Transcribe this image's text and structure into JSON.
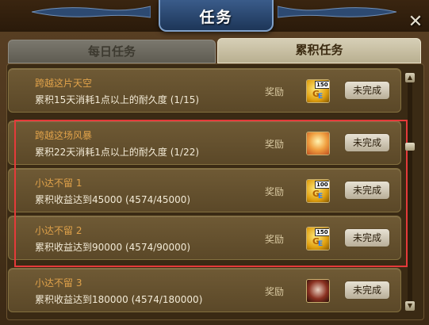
{
  "window": {
    "title": "任务",
    "close_glyph": "✕"
  },
  "tabs": [
    {
      "label": "每日任务",
      "active": false
    },
    {
      "label": "累积任务",
      "active": true
    }
  ],
  "tasks": [
    {
      "name": "跨越这片天空",
      "desc": "累积15天消耗1点以上的耐久度 (1/15)",
      "reward_label": "奖励",
      "reward_icon": "gold-150-icon",
      "reward_badge": "150",
      "button": "未完成"
    },
    {
      "name": "跨越这场风暴",
      "desc": "累积22天消耗1点以上的耐久度 (1/22)",
      "reward_label": "奖励",
      "reward_icon": "character-portrait-icon",
      "button": "未完成"
    },
    {
      "name": "小达不留 1",
      "desc": "累积收益达到45000 (4574/45000)",
      "reward_label": "奖励",
      "reward_icon": "gold-100-icon",
      "reward_badge": "100",
      "button": "未完成"
    },
    {
      "name": "小达不留 2",
      "desc": "累积收益达到90000 (4574/90000)",
      "reward_label": "奖励",
      "reward_icon": "gold-150-icon",
      "reward_badge": "150",
      "button": "未完成"
    },
    {
      "name": "小达不留 3",
      "desc": "累积收益达到180000 (4574/180000)",
      "reward_label": "奖励",
      "reward_icon": "skull-portrait-icon",
      "button": "未完成"
    }
  ],
  "colors": {
    "highlight": "#e53a3a",
    "task_name": "#e0a24a",
    "title_plaque": "#2b4a78"
  }
}
